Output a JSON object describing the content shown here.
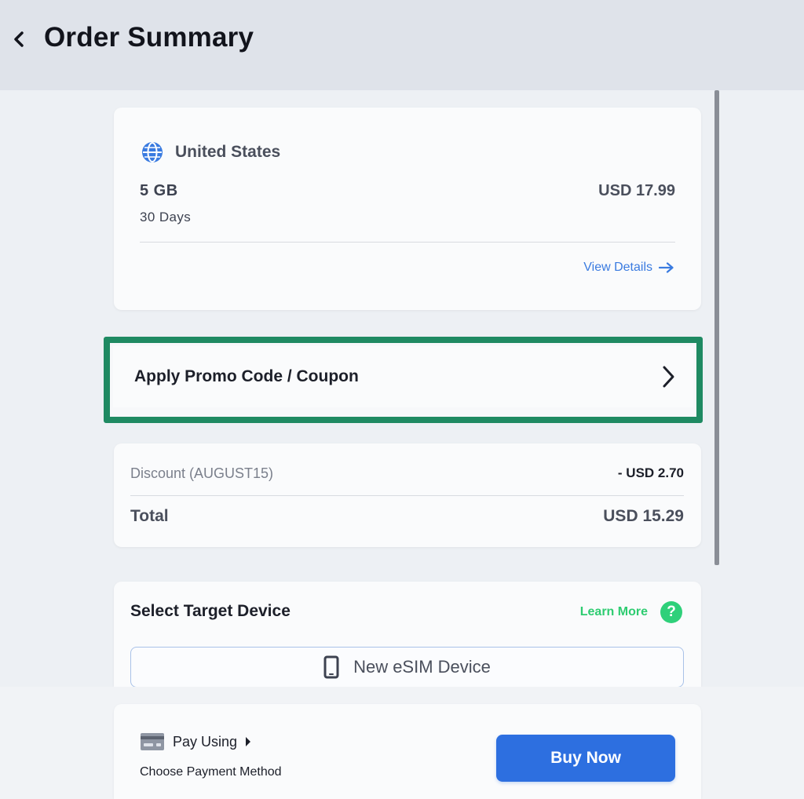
{
  "header": {
    "title": "Order Summary",
    "back_icon": "chevron-left-icon"
  },
  "plan": {
    "country": "United States",
    "country_icon": "globe-icon",
    "data": "5 GB",
    "duration": "30 Days",
    "price": "USD 17.99",
    "view_details_label": "View Details",
    "view_details_icon": "arrow-right-icon"
  },
  "promo": {
    "label": "Apply Promo Code / Coupon",
    "icon": "chevron-right-icon",
    "highlight_color": "#1f8a62"
  },
  "totals": {
    "discount_label": "Discount (AUGUST15)",
    "discount_value": "- USD 2.70",
    "total_label": "Total",
    "total_value": "USD 15.29"
  },
  "device": {
    "title": "Select Target Device",
    "learn_more_label": "Learn More",
    "help_icon": "question-circle-icon",
    "help_glyph": "?",
    "device_button_label": "New eSIM Device",
    "device_icon": "phone-icon"
  },
  "payment": {
    "pay_using_label": "Pay Using",
    "card_icon": "credit-card-icon",
    "caret_icon": "caret-right-icon",
    "method_label": "Choose Payment Method",
    "buy_label": "Buy Now",
    "accent_color": "#2d6fe0"
  }
}
